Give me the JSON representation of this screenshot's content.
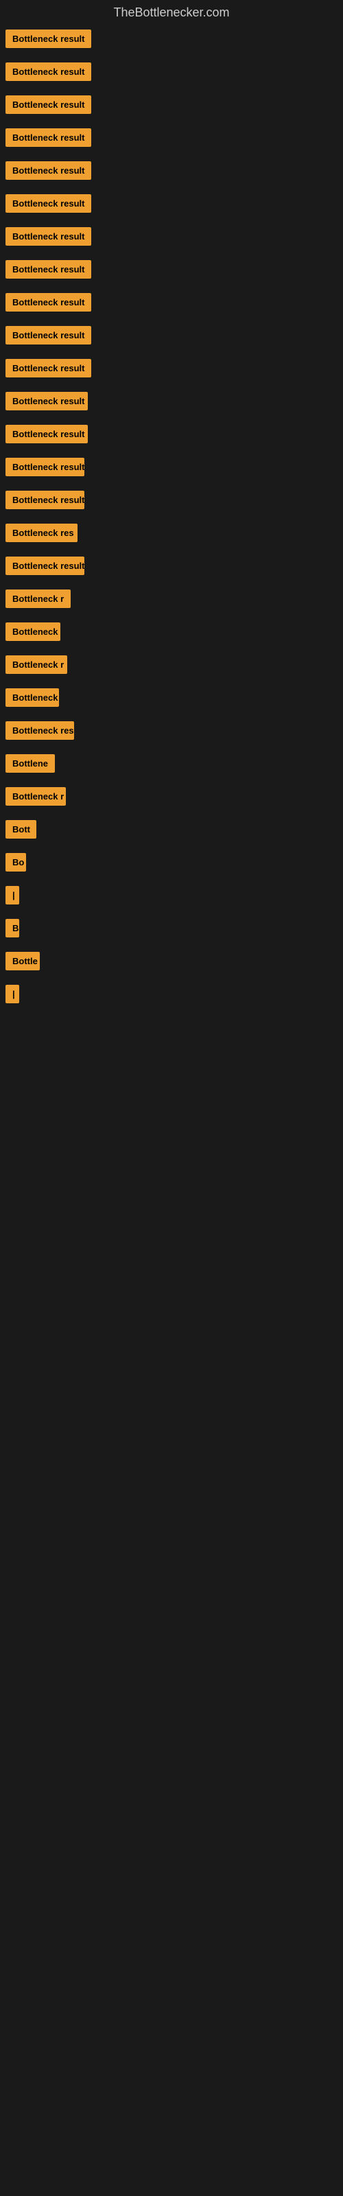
{
  "site_title": "TheBottlenecker.com",
  "items": [
    {
      "label": "Bottleneck result",
      "width": 130
    },
    {
      "label": "Bottleneck result",
      "width": 130
    },
    {
      "label": "Bottleneck result",
      "width": 130
    },
    {
      "label": "Bottleneck result",
      "width": 130
    },
    {
      "label": "Bottleneck result",
      "width": 130
    },
    {
      "label": "Bottleneck result",
      "width": 130
    },
    {
      "label": "Bottleneck result",
      "width": 130
    },
    {
      "label": "Bottleneck result",
      "width": 130
    },
    {
      "label": "Bottleneck result",
      "width": 130
    },
    {
      "label": "Bottleneck result",
      "width": 130
    },
    {
      "label": "Bottleneck result",
      "width": 130
    },
    {
      "label": "Bottleneck result",
      "width": 120
    },
    {
      "label": "Bottleneck result",
      "width": 120
    },
    {
      "label": "Bottleneck result",
      "width": 115
    },
    {
      "label": "Bottleneck result",
      "width": 115
    },
    {
      "label": "Bottleneck res",
      "width": 105
    },
    {
      "label": "Bottleneck result",
      "width": 115
    },
    {
      "label": "Bottleneck r",
      "width": 95
    },
    {
      "label": "Bottleneck",
      "width": 80
    },
    {
      "label": "Bottleneck r",
      "width": 90
    },
    {
      "label": "Bottleneck",
      "width": 78
    },
    {
      "label": "Bottleneck res",
      "width": 100
    },
    {
      "label": "Bottlene",
      "width": 72
    },
    {
      "label": "Bottleneck r",
      "width": 88
    },
    {
      "label": "Bott",
      "width": 45
    },
    {
      "label": "Bo",
      "width": 30
    },
    {
      "label": "|",
      "width": 10
    },
    {
      "label": "B",
      "width": 18
    },
    {
      "label": "Bottle",
      "width": 50
    },
    {
      "label": "|",
      "width": 10
    }
  ]
}
